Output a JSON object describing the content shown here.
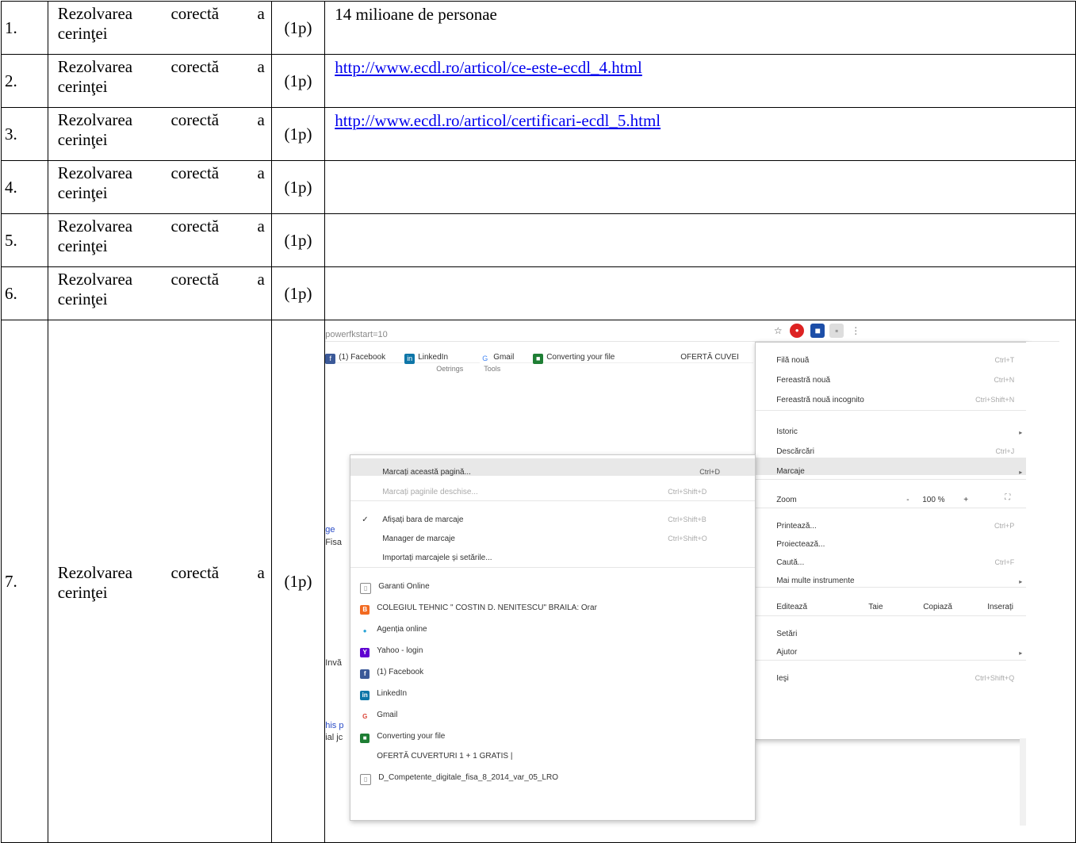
{
  "rows": [
    {
      "num": "1.",
      "crit_a": "Rezolvarea corectă a",
      "crit_b": "cerinţei",
      "pts": "(1p)",
      "answer": "14 milioane de personae"
    },
    {
      "num": "2.",
      "crit_a": "Rezolvarea corectă a",
      "crit_b": "cerinţei",
      "pts": "(1p)",
      "answer": "http://www.ecdl.ro/articol/ce-este-ecdl_4.html"
    },
    {
      "num": "3.",
      "crit_a": "Rezolvarea corectă a",
      "crit_b": "cerinţei",
      "pts": "(1p)",
      "answer": "http://www.ecdl.ro/articol/certificari-ecdl_5.html"
    },
    {
      "num": "4.",
      "crit_a": "Rezolvarea corectă a",
      "crit_b": "cerinţei",
      "pts": "(1p)",
      "answer": ""
    },
    {
      "num": "5.",
      "crit_a": "Rezolvarea corectă a",
      "crit_b": "cerinţei",
      "pts": "(1p)",
      "answer": ""
    },
    {
      "num": "6.",
      "crit_a": "Rezolvarea corectă a",
      "crit_b": "cerinţei",
      "pts": "(1p)",
      "answer": ""
    },
    {
      "num": "7.",
      "crit_a": "Rezolvarea corectă a",
      "crit_b": "cerinţei",
      "pts": "(1p)"
    }
  ],
  "screenshot": {
    "url_fragment": "powerfkstart=10",
    "bookmarks_bar": [
      "(1) Facebook",
      "LinkedIn",
      "Gmail",
      "Converting your file",
      "OFERTĂ CUVEI"
    ],
    "page_fragments": [
      "Oetrings",
      "Tools",
      "ge",
      "Fisa",
      "Invă",
      "his p",
      "ial jc"
    ],
    "chrome_menu": {
      "items": [
        {
          "label": "Filă nouă",
          "shortcut": "Ctrl+T"
        },
        {
          "label": "Fereastră nouă",
          "shortcut": "Ctrl+N"
        },
        {
          "label": "Fereastră nouă incognito",
          "shortcut": "Ctrl+Shift+N"
        },
        {
          "label": "Istoric",
          "shortcut": ""
        },
        {
          "label": "Descărcări",
          "shortcut": "Ctrl+J"
        },
        {
          "label": "Marcaje",
          "shortcut": ""
        },
        {
          "label": "Zoom",
          "shortcut": ""
        },
        {
          "label": "Printează...",
          "shortcut": "Ctrl+P"
        },
        {
          "label": "Proiectează...",
          "shortcut": ""
        },
        {
          "label": "Caută...",
          "shortcut": "Ctrl+F"
        },
        {
          "label": "Mai multe instrumente",
          "shortcut": ""
        },
        {
          "label": "Setări",
          "shortcut": ""
        },
        {
          "label": "Ajutor",
          "shortcut": ""
        },
        {
          "label": "Ieşi",
          "shortcut": "Ctrl+Shift+Q"
        }
      ],
      "zoom_minus": "-",
      "zoom_value": "100 %",
      "zoom_plus": "+",
      "edit_label": "Editează",
      "cut": "Taie",
      "copy": "Copiază",
      "paste": "Inserați"
    },
    "bookmarks_menu": {
      "items": [
        {
          "label": "Marcați această pagină...",
          "shortcut": "Ctrl+D"
        },
        {
          "label": "Marcați paginile deschise...",
          "shortcut": "Ctrl+Shift+D"
        },
        {
          "label": "Afișați bara de marcaje",
          "shortcut": "Ctrl+Shift+B"
        },
        {
          "label": "Manager de marcaje",
          "shortcut": "Ctrl+Shift+O"
        },
        {
          "label": "Importați marcajele și setările...",
          "shortcut": ""
        }
      ],
      "bookmarks": [
        "Garanti Online",
        "COLEGIUL TEHNIC \" COSTIN D. NENITESCU\" BRAILA: Orar",
        "Agenția online",
        "Yahoo - login",
        "(1) Facebook",
        "LinkedIn",
        "Gmail",
        "Converting your file",
        "OFERTĂ CUVERTURI 1 + 1 GRATIS |",
        "D_Competente_digitale_fisa_8_2014_var_05_LRO"
      ]
    }
  }
}
